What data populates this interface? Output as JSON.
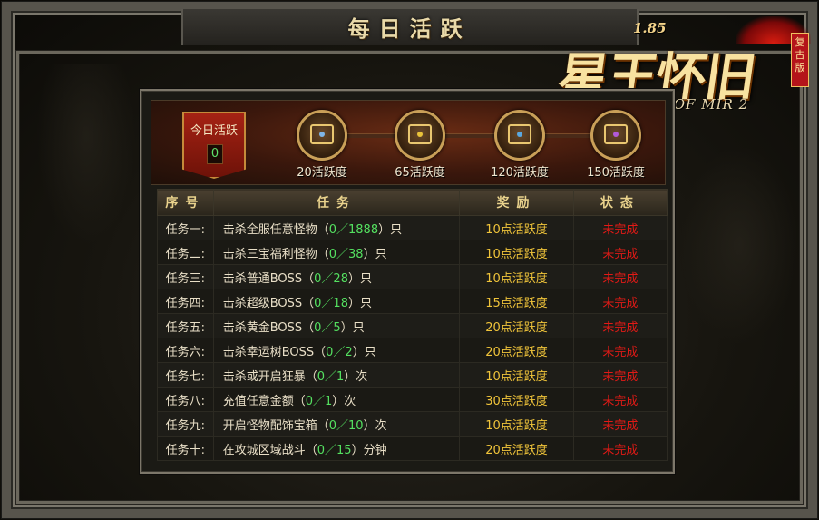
{
  "window": {
    "title": "每日活跃"
  },
  "logo": {
    "version": "1.85",
    "main": "星王怀旧",
    "sub": "LEGEND OF MIR 2",
    "badge": "复古版"
  },
  "activity": {
    "label": "今日活跃",
    "value": "0"
  },
  "chests": [
    {
      "label": "20活跃度",
      "gem": "#7fb6e8"
    },
    {
      "label": "65活跃度",
      "gem": "#e9c33a"
    },
    {
      "label": "120活跃度",
      "gem": "#5aa8e0"
    },
    {
      "label": "150活跃度",
      "gem": "#b25ad8"
    }
  ],
  "table": {
    "headers": [
      "序号",
      "任务",
      "奖励",
      "状态"
    ],
    "rows": [
      {
        "idx": "任务一:",
        "pre": "击杀全服任意怪物（",
        "prog": "0／1888",
        "post": "）只",
        "reward": "10点活跃度",
        "status": "未完成"
      },
      {
        "idx": "任务二:",
        "pre": "击杀三宝福利怪物（",
        "prog": "0／38",
        "post": "）只",
        "reward": "10点活跃度",
        "status": "未完成"
      },
      {
        "idx": "任务三:",
        "pre": "击杀普通BOSS（",
        "prog": "0／28",
        "post": "）只",
        "reward": "10点活跃度",
        "status": "未完成"
      },
      {
        "idx": "任务四:",
        "pre": "击杀超级BOSS（",
        "prog": "0／18",
        "post": "）只",
        "reward": "15点活跃度",
        "status": "未完成"
      },
      {
        "idx": "任务五:",
        "pre": "击杀黄金BOSS（",
        "prog": "0／5",
        "post": "）只",
        "reward": "20点活跃度",
        "status": "未完成"
      },
      {
        "idx": "任务六:",
        "pre": "击杀幸运树BOSS（",
        "prog": "0／2",
        "post": "）只",
        "reward": "20点活跃度",
        "status": "未完成"
      },
      {
        "idx": "任务七:",
        "pre": "击杀或开启狂暴（",
        "prog": "0／1",
        "post": "）次",
        "reward": "10点活跃度",
        "status": "未完成"
      },
      {
        "idx": "任务八:",
        "pre": "充值任意金额（",
        "prog": "0／1",
        "post": "）次",
        "reward": "30点活跃度",
        "status": "未完成"
      },
      {
        "idx": "任务九:",
        "pre": "开启怪物配饰宝箱（",
        "prog": "0／10",
        "post": "）次",
        "reward": "10点活跃度",
        "status": "未完成"
      },
      {
        "idx": "任务十:",
        "pre": "在攻城区域战斗（",
        "prog": "0／15",
        "post": "）分钟",
        "reward": "20点活跃度",
        "status": "未完成"
      }
    ]
  }
}
